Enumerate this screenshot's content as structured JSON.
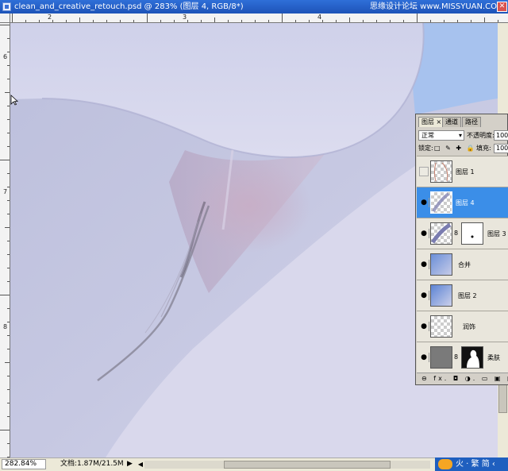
{
  "window": {
    "title": "clean_and_creative_retouch.psd @ 283% (图层 4, RGB/8*)",
    "watermark": "思缘设计论坛 www.MISSYUAN.COM",
    "close_glyph": "✕"
  },
  "rulers": {
    "top_numbers": [
      "2",
      "3",
      "4"
    ],
    "left_numbers": [
      "6",
      "7",
      "8"
    ]
  },
  "status": {
    "zoom": "282.84%",
    "doc_info": "文档:1.87M/21.5M",
    "arrow": "▶",
    "scroll_left": "◀"
  },
  "ime": {
    "text": "火 · 繁 简 ‹"
  },
  "layers_panel": {
    "tabs": [
      {
        "label": "图层 ×",
        "active": true
      },
      {
        "label": "通道",
        "active": false
      },
      {
        "label": "路径",
        "active": false
      }
    ],
    "blend_mode": "正常",
    "opacity_label": "不透明度:",
    "opacity_value": "100%",
    "lock_label": "锁定:",
    "lock_icons": "□ ✎ ✚ 🔒",
    "fill_label": "填充:",
    "fill_value": "100%",
    "layers": [
      {
        "name": "图层 1",
        "visible": false,
        "selected": false,
        "has_mask": false
      },
      {
        "name": "图层 4",
        "visible": true,
        "selected": true,
        "has_mask": false
      },
      {
        "name": "图层 3",
        "visible": true,
        "selected": false,
        "has_mask": true
      },
      {
        "name": "合并",
        "visible": true,
        "selected": false,
        "has_mask": false
      },
      {
        "name": "图层 2",
        "visible": true,
        "selected": false,
        "has_mask": false
      },
      {
        "name": "润饰",
        "visible": true,
        "selected": false,
        "has_mask": false
      },
      {
        "name": "柔肤",
        "visible": true,
        "selected": false,
        "has_mask": true
      }
    ],
    "bottom_icons": "⊖ fx. ◘ ◑. ▭ ▣ ▥",
    "eye_glyph": "●",
    "chain_glyph": "8"
  },
  "colors": {
    "selection": "#3b8ee8",
    "skin": "#c9cbe4"
  }
}
